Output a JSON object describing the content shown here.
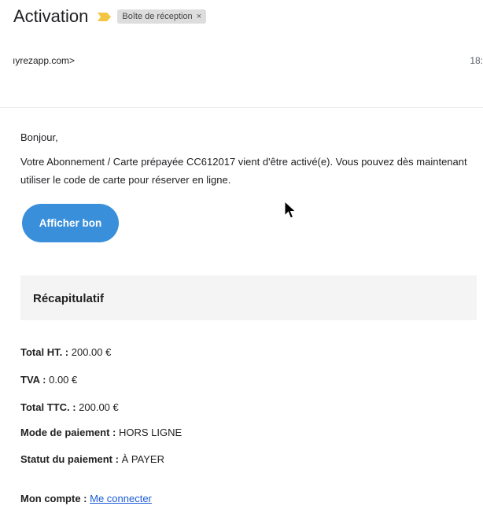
{
  "email": {
    "subject": "Activation",
    "label": "Boîte de réception",
    "label_remove": "×",
    "sender": "ıyrezapp.com>",
    "time": "18:"
  },
  "body": {
    "greeting": "Bonjour,",
    "message": "Votre Abonnement / Carte prépayée CC612017 vient d'être activé(e). Vous pouvez dès maintenant utiliser le code de carte pour réserver en ligne.",
    "button_label": "Afficher bon"
  },
  "summary": {
    "title": "Récapitulatif",
    "rows": [
      {
        "label": "Total HT. :",
        "value": " 200.00 €"
      },
      {
        "label": "TVA :",
        "value": " 0.00 €"
      },
      {
        "label": "Total TTC. :",
        "value": " 200.00 €"
      },
      {
        "label": "Mode de paiement :",
        "value": " HORS LIGNE"
      },
      {
        "label": "Statut du paiement :",
        "value": " À PAYER"
      }
    ]
  },
  "account": {
    "label": "Mon compte :",
    "link": "Me connecter"
  },
  "colors": {
    "button": "#3a8fdb",
    "importance_marker": "#f4c542",
    "link": "#1a5bd8"
  },
  "icons": {
    "importance": "importance-marker-icon",
    "cursor": "mouse-pointer-icon"
  }
}
